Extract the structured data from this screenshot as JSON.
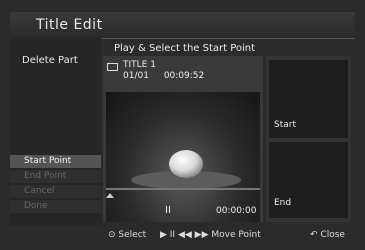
{
  "app": {
    "title": "Title Edit"
  },
  "left": {
    "heading": "Delete Part",
    "menu": [
      {
        "label": "Start Point",
        "active": true
      },
      {
        "label": "End Point",
        "active": false
      },
      {
        "label": "Cancel",
        "active": false
      },
      {
        "label": "Done",
        "active": false
      }
    ]
  },
  "instruction": "Play & Select the Start Point",
  "video": {
    "title": "TITLE 1",
    "index": "01/01",
    "duration": "00:09:52",
    "playback_symbol": "II",
    "timecode": "00:00:00",
    "progress": 0.0
  },
  "right": {
    "start_label": "Start",
    "end_label": "End"
  },
  "footer": {
    "select": "Select",
    "move_point": "Move Point",
    "close": "Close"
  }
}
